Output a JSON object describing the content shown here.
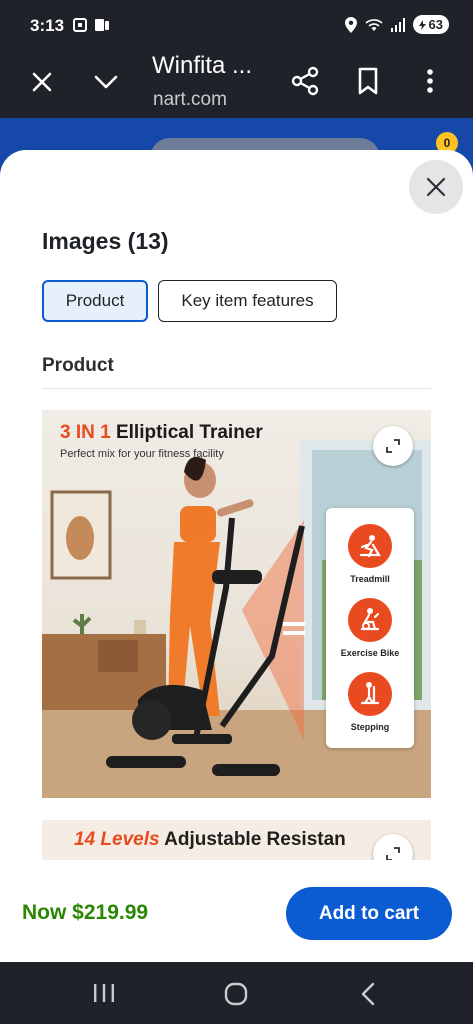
{
  "status_bar": {
    "time": "3:13",
    "battery": "63",
    "icons": [
      "screenshot-icon",
      "phone-link-icon",
      "location-icon",
      "wifi-icon",
      "signal-icon",
      "battery-icon"
    ]
  },
  "browser": {
    "title": "Winfita ...",
    "url": "nart.com"
  },
  "background_page": {
    "cart_count": "0"
  },
  "sheet": {
    "title": "Images (13)",
    "tabs": [
      {
        "label": "Product",
        "selected": true
      },
      {
        "label": "Key item features",
        "selected": false
      }
    ],
    "section_title": "Product",
    "images": [
      {
        "headline_accent": "3 IN 1",
        "headline_rest": " Elliptical Trainer",
        "subtitle": "Perfect mix for your fitness facility",
        "features": [
          "Treadmill",
          "Exercise Bike",
          "Stepping"
        ]
      },
      {
        "headline_accent": "14 Levels",
        "headline_rest": " Adjustable Resistan"
      }
    ]
  },
  "bottom_bar": {
    "price": "Now $219.99",
    "add_to_cart": "Add to cart"
  },
  "colors": {
    "accent_blue": "#0b5bd3",
    "price_green": "#2a8703",
    "brand_orange": "#e94a1f",
    "dark_chrome": "#1f2228"
  }
}
